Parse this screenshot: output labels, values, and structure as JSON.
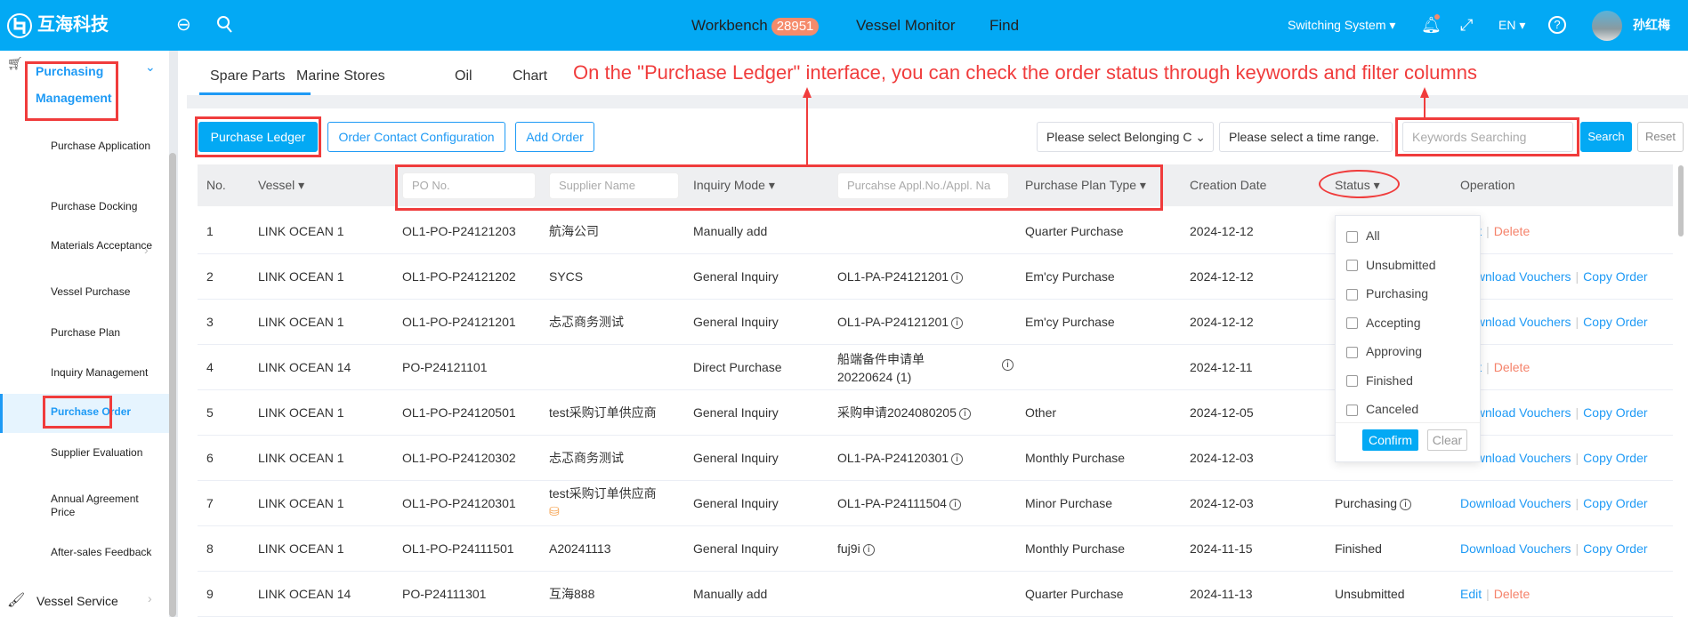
{
  "header": {
    "logo_text": "互海科技",
    "nav": [
      {
        "label": "Workbench",
        "badge": "28951"
      },
      {
        "label": "Vessel Monitor"
      },
      {
        "label": "Find"
      }
    ],
    "switch_system": "Switching System",
    "lang": "EN",
    "user": "孙红梅"
  },
  "sidebar": {
    "group": {
      "label_line1": "Purchasing",
      "label_line2": "Management"
    },
    "items": [
      "Purchase Application",
      "Purchase Docking",
      "Materials Acceptance",
      "Vessel Purchase",
      "Purchase Plan",
      "Inquiry Management",
      "Purchase Order",
      "Supplier Evaluation",
      "Annual Agreement Price",
      "After-sales Feedback"
    ],
    "active": "Purchase Order",
    "next_group": "Vessel Service"
  },
  "tabs": [
    "Spare Parts",
    "Marine Stores",
    "Oil",
    "Chart"
  ],
  "annotation": "On the \"Purchase Ledger\" interface, you can check the order status through keywords and filter columns",
  "toolbar": {
    "purchase_ledger": "Purchase Ledger",
    "order_contact": "Order Contact Configuration",
    "add_order": "Add Order",
    "belonging_placeholder": "Please select Belonging C",
    "time_placeholder": "Please select a time range.",
    "keywords_placeholder": "Keywords Searching",
    "search": "Search",
    "reset": "Reset"
  },
  "table": {
    "headers": {
      "no": "No.",
      "vessel": "Vessel",
      "po_placeholder": "PO No.",
      "supplier_placeholder": "Supplier Name",
      "inquiry": "Inquiry Mode",
      "appl_placeholder": "Purcahse Appl.No./Appl. Na",
      "plan": "Purchase Plan Type",
      "date": "Creation Date",
      "status": "Status",
      "op": "Operation"
    },
    "rows": [
      {
        "no": "1",
        "vessel": "LINK OCEAN 1",
        "po": "OL1-PO-P24121203",
        "supplier": "航海公司",
        "inquiry": "Manually add",
        "appl": "",
        "plan": "Quarter Purchase",
        "date": "2024-12-12",
        "status": "",
        "ops": [
          "Edit",
          "Delete"
        ]
      },
      {
        "no": "2",
        "vessel": "LINK OCEAN 1",
        "po": "OL1-PO-P24121202",
        "supplier": "SYCS",
        "inquiry": "General Inquiry",
        "appl": "OL1-PA-P24121201",
        "plan": "Em'cy Purchase",
        "date": "2024-12-12",
        "status": "",
        "ops": [
          "Download Vouchers",
          "Copy Order"
        ]
      },
      {
        "no": "3",
        "vessel": "LINK OCEAN 1",
        "po": "OL1-PO-P24121201",
        "supplier": "忐忑商务测试",
        "inquiry": "General Inquiry",
        "appl": "OL1-PA-P24121201",
        "plan": "Em'cy Purchase",
        "date": "2024-12-12",
        "status": "",
        "ops": [
          "Download Vouchers",
          "Copy Order"
        ]
      },
      {
        "no": "4",
        "vessel": "LINK OCEAN 14",
        "po": "PO-P24121101",
        "supplier": "",
        "inquiry": "Direct Purchase",
        "appl": "船端备件申请单20220624 (1)",
        "plan": "",
        "date": "2024-12-11",
        "status": "",
        "ops": [
          "Edit",
          "Delete"
        ]
      },
      {
        "no": "5",
        "vessel": "LINK OCEAN 1",
        "po": "OL1-PO-P24120501",
        "supplier": "test采购订单供应商",
        "inquiry": "General Inquiry",
        "appl": "采购申请2024080205",
        "plan": "Other",
        "date": "2024-12-05",
        "status": "",
        "ops": [
          "Download Vouchers",
          "Copy Order"
        ]
      },
      {
        "no": "6",
        "vessel": "LINK OCEAN 1",
        "po": "OL1-PO-P24120302",
        "supplier": "忐忑商务测试",
        "inquiry": "General Inquiry",
        "appl": "OL1-PA-P24120301",
        "plan": "Monthly Purchase",
        "date": "2024-12-03",
        "status": "",
        "ops": [
          "Download Vouchers",
          "Copy Order"
        ]
      },
      {
        "no": "7",
        "vessel": "LINK OCEAN 1",
        "po": "OL1-PO-P24120301",
        "supplier": "test采购订单供应商",
        "inquiry": "General Inquiry",
        "appl": "OL1-PA-P24111504",
        "plan": "Minor Purchase",
        "date": "2024-12-03",
        "status": "Purchasing",
        "ops": [
          "Download Vouchers",
          "Copy Order"
        ]
      },
      {
        "no": "8",
        "vessel": "LINK OCEAN 1",
        "po": "OL1-PO-P24111501",
        "supplier": "A20241113",
        "inquiry": "General Inquiry",
        "appl": "fuj9i",
        "plan": "Monthly Purchase",
        "date": "2024-11-15",
        "status": "Finished",
        "ops": [
          "Download Vouchers",
          "Copy Order"
        ]
      },
      {
        "no": "9",
        "vessel": "LINK OCEAN 14",
        "po": "PO-P24111301",
        "supplier": "互海888",
        "inquiry": "Manually add",
        "appl": "",
        "plan": "Quarter Purchase",
        "date": "2024-11-13",
        "status": "Unsubmitted",
        "ops": [
          "Edit",
          "Delete"
        ]
      }
    ]
  },
  "status_filter": {
    "options": [
      "All",
      "Unsubmitted",
      "Purchasing",
      "Accepting",
      "Approving",
      "Finished",
      "Canceled"
    ],
    "confirm": "Confirm",
    "clear": "Clear"
  },
  "colors": {
    "primary": "#03a9f4",
    "link": "#1e9af5",
    "danger": "#f5836b",
    "annotation": "#f03c3c"
  }
}
